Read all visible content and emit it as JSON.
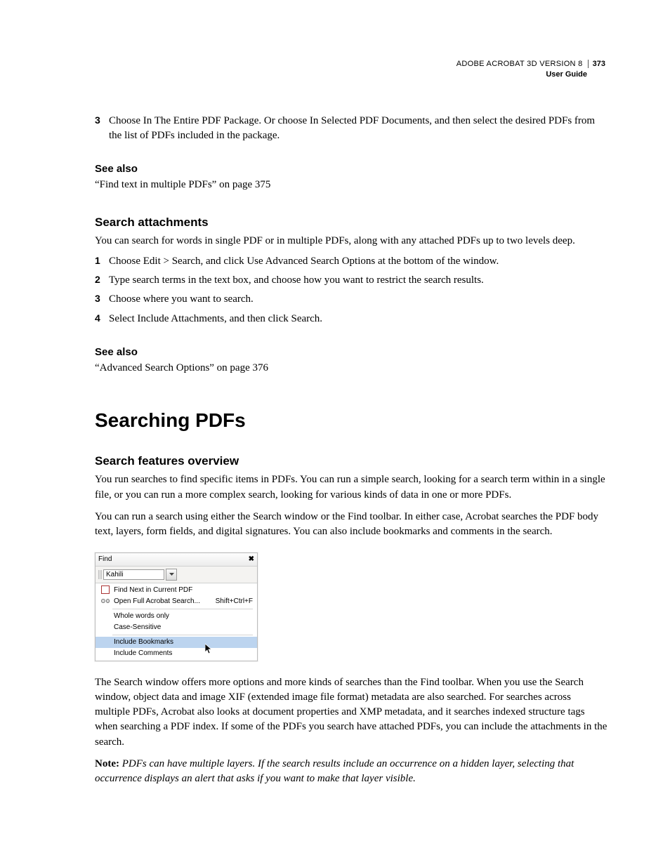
{
  "header": {
    "product": "ADOBE ACROBAT 3D VERSION 8",
    "page_number": "373",
    "subtitle": "User Guide"
  },
  "intro_step": {
    "num": "3",
    "text": "Choose In The Entire PDF Package. Or choose In Selected PDF Documents, and then select the desired PDFs from the list of PDFs included in the package."
  },
  "see_also_1": {
    "heading": "See also",
    "link": "“Find text in multiple PDFs” on page 375"
  },
  "search_attachments": {
    "heading": "Search attachments",
    "intro": "You can search for words in single PDF or in multiple PDFs, along with any attached PDFs up to two levels deep.",
    "steps": [
      {
        "num": "1",
        "text": "Choose Edit > Search, and click Use Advanced Search Options at the bottom of the window."
      },
      {
        "num": "2",
        "text": "Type search terms in the text box, and choose how you want to restrict the search results."
      },
      {
        "num": "3",
        "text": "Choose where you want to search."
      },
      {
        "num": "4",
        "text": "Select Include Attachments, and then click Search."
      }
    ]
  },
  "see_also_2": {
    "heading": "See also",
    "link": "“Advanced Search Options” on page 376"
  },
  "main_heading": "Searching PDFs",
  "overview": {
    "heading": "Search features overview",
    "p1": "You run searches to find specific items in PDFs. You can run a simple search, looking for a search term within in a single file, or you can run a more complex search, looking for various kinds of data in one or more PDFs.",
    "p2": "You can run a search using either the Search window or the Find toolbar. In either case, Acrobat searches the PDF body text, layers, form fields, and digital signatures. You can also include bookmarks and comments in the search."
  },
  "find_toolbar": {
    "title": "Find",
    "close": "✖",
    "input_value": "Kahili",
    "menu": {
      "find_next": "Find Next in Current PDF",
      "open_full": "Open Full Acrobat Search...",
      "shortcut": "Shift+Ctrl+F",
      "whole_words": "Whole words only",
      "case_sensitive": "Case-Sensitive",
      "include_bookmarks": "Include Bookmarks",
      "include_comments": "Include Comments"
    }
  },
  "after_figure": {
    "p1": "The Search window offers more options and more kinds of searches than the Find toolbar. When you use the Search window, object data and image XIF (extended image file format) metadata are also searched. For searches across multiple PDFs, Acrobat also looks at document properties and XMP metadata, and it searches indexed structure tags when searching a PDF index. If some of the PDFs you search have attached PDFs, you can include the attachments in the search.",
    "note_label": "Note:",
    "note_text": " PDFs can have multiple layers. If the search results include an occurrence on a hidden layer, selecting that occurrence displays an alert that asks if you want to make that layer visible."
  }
}
